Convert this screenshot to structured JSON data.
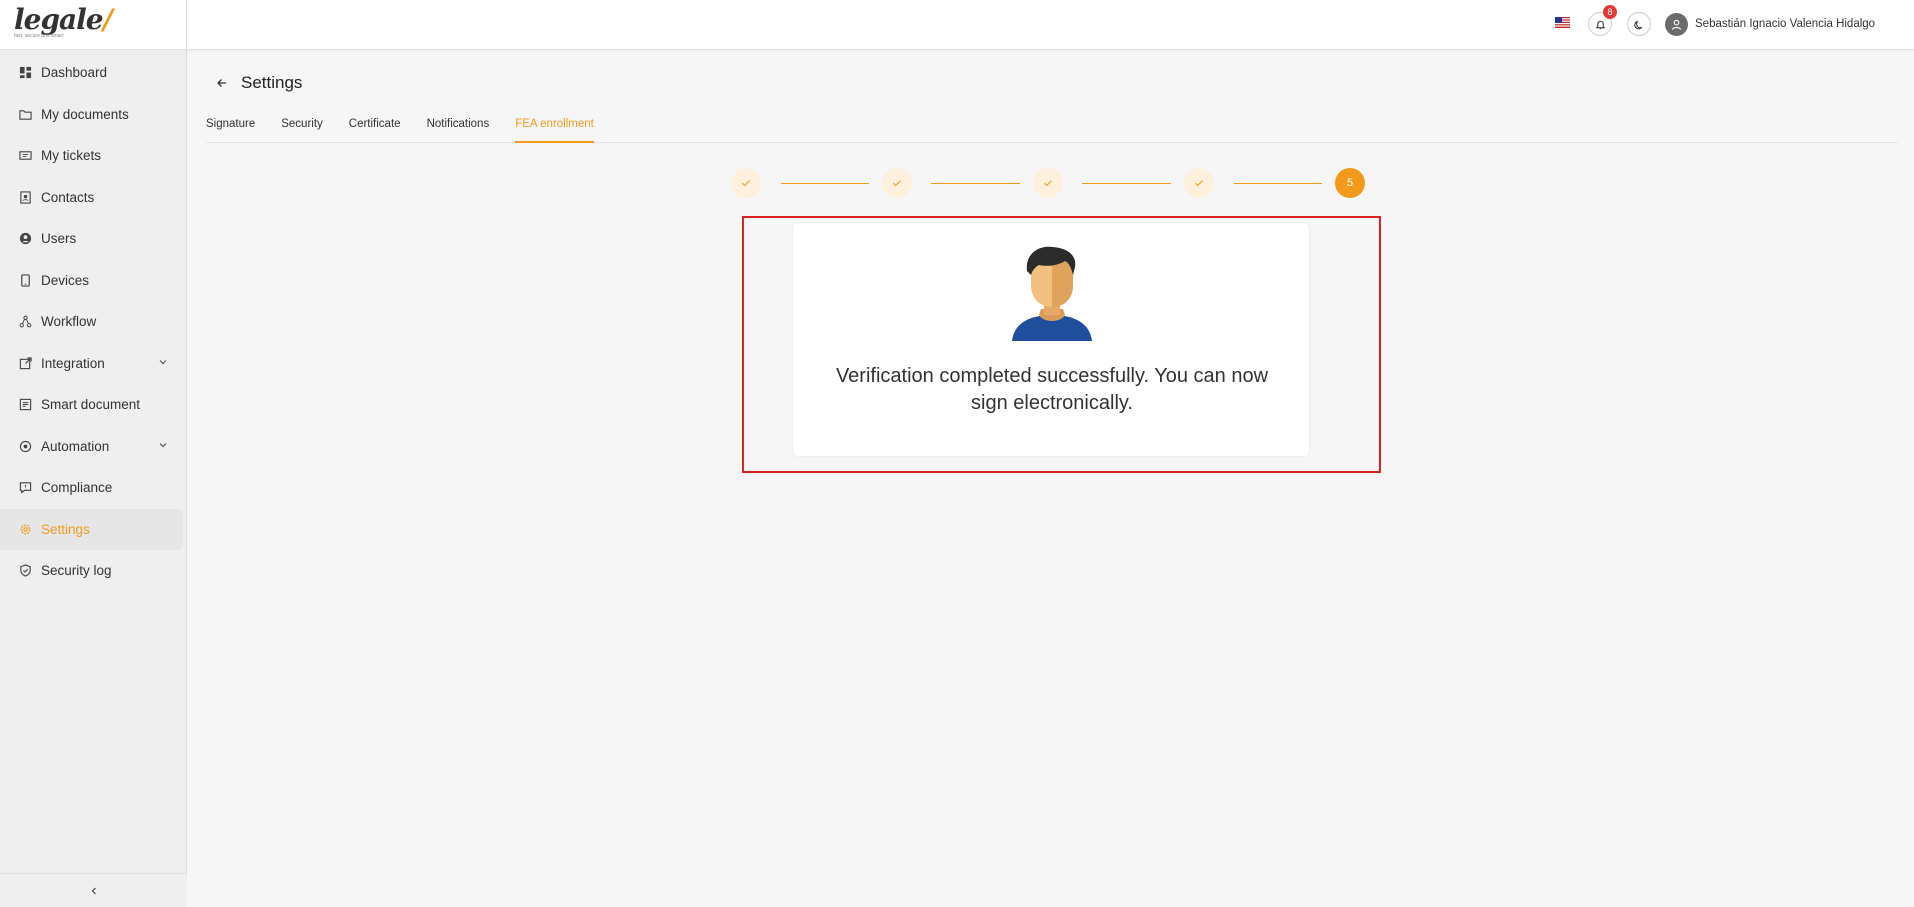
{
  "app": {
    "logo_text": "legale",
    "logo_tagline": "fast, secure and smart"
  },
  "sidebar": {
    "items": [
      {
        "label": "Dashboard",
        "icon": "dashboard-icon"
      },
      {
        "label": "My documents",
        "icon": "folder-icon"
      },
      {
        "label": "My tickets",
        "icon": "ticket-icon"
      },
      {
        "label": "Contacts",
        "icon": "contacts-icon"
      },
      {
        "label": "Users",
        "icon": "user-icon"
      },
      {
        "label": "Devices",
        "icon": "device-icon"
      },
      {
        "label": "Workflow",
        "icon": "workflow-icon"
      },
      {
        "label": "Integration",
        "icon": "integration-icon",
        "expandable": true
      },
      {
        "label": "Smart document",
        "icon": "smart-document-icon"
      },
      {
        "label": "Automation",
        "icon": "automation-icon",
        "expandable": true
      },
      {
        "label": "Compliance",
        "icon": "compliance-icon"
      },
      {
        "label": "Settings",
        "icon": "gear-icon",
        "active": true
      },
      {
        "label": "Security log",
        "icon": "shield-icon"
      }
    ],
    "collapse_icon": "chevron-left-icon"
  },
  "topbar": {
    "language_icon": "us-flag-icon",
    "notifications_count": "8",
    "theme_icon": "moon-icon",
    "user_name": "Sebastián Ignacio Valencia Hidalgo"
  },
  "page": {
    "title": "Settings",
    "tabs": [
      {
        "label": "Signature"
      },
      {
        "label": "Security"
      },
      {
        "label": "Certificate"
      },
      {
        "label": "Notifications"
      },
      {
        "label": "FEA enrollment",
        "active": true
      }
    ]
  },
  "stepper": {
    "steps": [
      {
        "state": "done"
      },
      {
        "state": "done"
      },
      {
        "state": "done"
      },
      {
        "state": "done"
      },
      {
        "state": "current",
        "label": "5"
      }
    ]
  },
  "result": {
    "illustration": "person-avatar-illustration",
    "message": "Verification completed successfully. You can now sign electronically."
  },
  "colors": {
    "accent": "#f39a1b",
    "highlight_border": "#d9231f",
    "badge": "#e53935"
  }
}
